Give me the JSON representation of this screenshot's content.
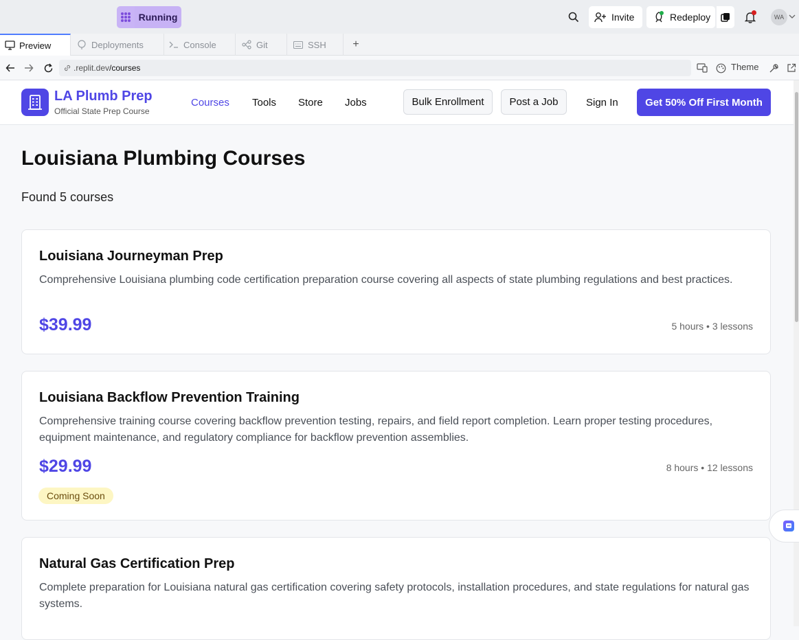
{
  "topbar": {
    "run_status": "Running",
    "invite_label": "Invite",
    "redeploy_label": "Redeploy",
    "avatar_initials": "WA"
  },
  "tabs": [
    {
      "label": "Preview",
      "icon": "monitor-icon",
      "active": true
    },
    {
      "label": "Deployments",
      "icon": "deployments-icon",
      "active": false
    },
    {
      "label": "Console",
      "icon": "terminal-icon",
      "active": false
    },
    {
      "label": "Git",
      "icon": "git-icon",
      "active": false
    },
    {
      "label": "SSH",
      "icon": "keyboard-icon",
      "active": false
    }
  ],
  "address": {
    "url_host": ".replit.dev",
    "url_path": "/courses",
    "theme_label": "Theme"
  },
  "site": {
    "brand_name": "LA Plumb Prep",
    "brand_subtitle": "Official State Prep Course",
    "nav": [
      "Courses",
      "Tools",
      "Store",
      "Jobs"
    ],
    "bulk_label": "Bulk Enrollment",
    "post_job_label": "Post a Job",
    "signin_label": "Sign In",
    "cta_label": "Get 50% Off First Month",
    "accent": "#4f46e5"
  },
  "main": {
    "title": "Louisiana Plumbing Courses",
    "found_text": "Found 5 courses",
    "courses": [
      {
        "title": "Louisiana Journeyman Prep",
        "description": "Comprehensive Louisiana plumbing code certification preparation course covering all aspects of state plumbing regulations and best practices.",
        "price": "$39.99",
        "meta": "5 hours • 3 lessons"
      },
      {
        "title": "Louisiana Backflow Prevention Training",
        "description": "Comprehensive training course covering backflow prevention testing, repairs, and field report completion. Learn proper testing procedures, equipment maintenance, and regulatory compliance for backflow prevention assemblies.",
        "price": "$29.99",
        "meta": "8 hours • 12 lessons",
        "badge": "Coming Soon"
      },
      {
        "title": "Natural Gas Certification Prep",
        "description": "Complete preparation for Louisiana natural gas certification covering safety protocols, installation procedures, and state regulations for natural gas systems."
      }
    ]
  }
}
